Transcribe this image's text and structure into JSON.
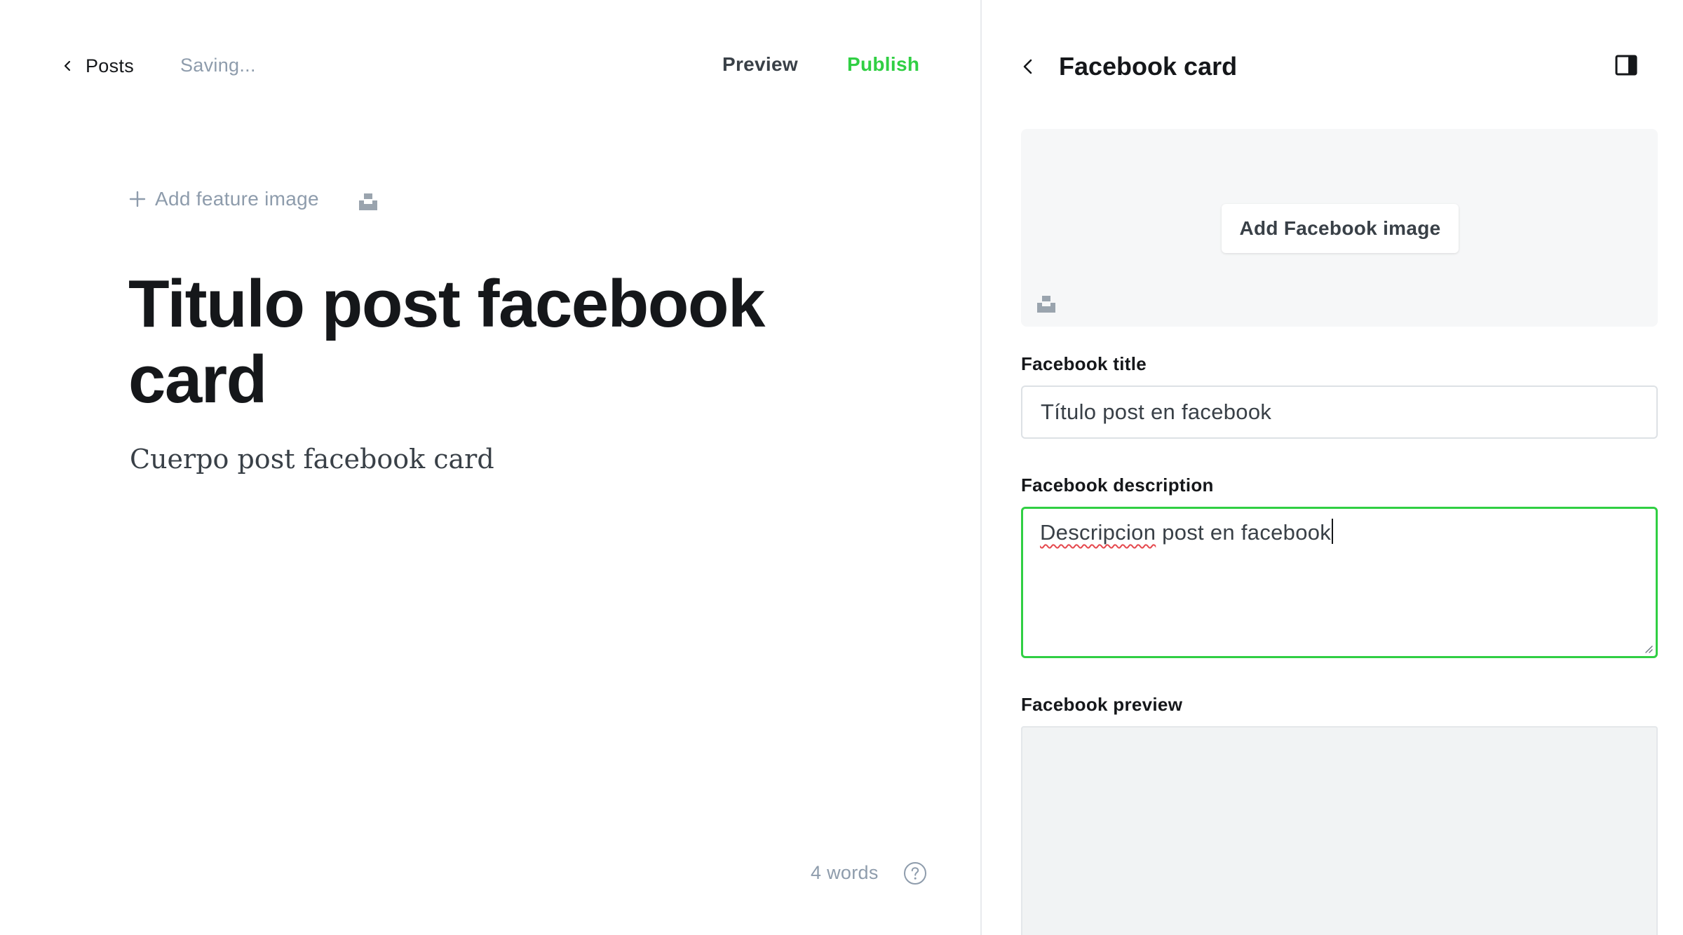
{
  "editor": {
    "back_label": "Posts",
    "status": "Saving...",
    "preview_label": "Preview",
    "publish_label": "Publish",
    "add_feature_image_label": "Add feature image",
    "post_title": "Titulo post facebook card",
    "post_body": "Cuerpo post facebook card",
    "word_count": "4 words",
    "help_icon": "question-circle-icon"
  },
  "panel": {
    "title": "Facebook card",
    "add_image_label": "Add Facebook image",
    "title_label": "Facebook title",
    "title_value": "Título post en facebook",
    "description_label": "Facebook description",
    "description_value_misspelled": "Descripcion",
    "description_value_rest": " post en facebook",
    "preview_label": "Facebook preview"
  },
  "colors": {
    "accent_green": "#30cf43",
    "muted_text": "#8e9cac",
    "heading_text": "#15171a"
  }
}
